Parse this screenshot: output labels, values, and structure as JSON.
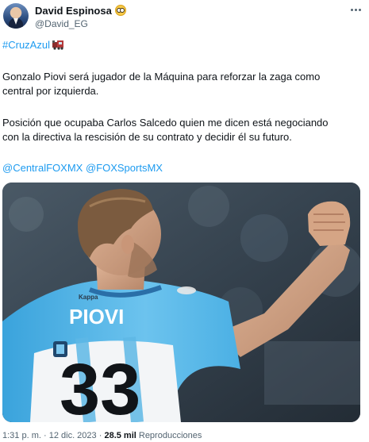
{
  "author": {
    "display_name": "David Espinosa",
    "handle": "@David_EG",
    "emoji_icon": "nerd-face-emoji"
  },
  "tweet": {
    "hashtag": "#CruzAzul",
    "hashtag_icon": "train-emoji",
    "line1": "Gonzalo Piovi será jugador de la Máquina para reforzar la zaga como",
    "line2": "central por izquierda.",
    "line3": "Posición que ocupaba Carlos Salcedo quien me dicen está negociando",
    "line4": "con la directiva la rescisión de su contrato y decidir él su futuro.",
    "mention1": "@CentralFOXMX",
    "mention2": "@FOXSportsMX"
  },
  "media": {
    "jersey_name": "PIOVI",
    "jersey_number": "33",
    "jersey_brand": "Kappa"
  },
  "footer": {
    "time": "1:31 p. m.",
    "separator": "·",
    "date": "12 dic. 2023",
    "views_count": "28.5 mil",
    "views_label": "Reproducciones"
  },
  "colors": {
    "link": "#1d9bf0",
    "jersey_sky_blue": "#58b7e8",
    "text": "#0f1419",
    "muted": "#536471"
  }
}
